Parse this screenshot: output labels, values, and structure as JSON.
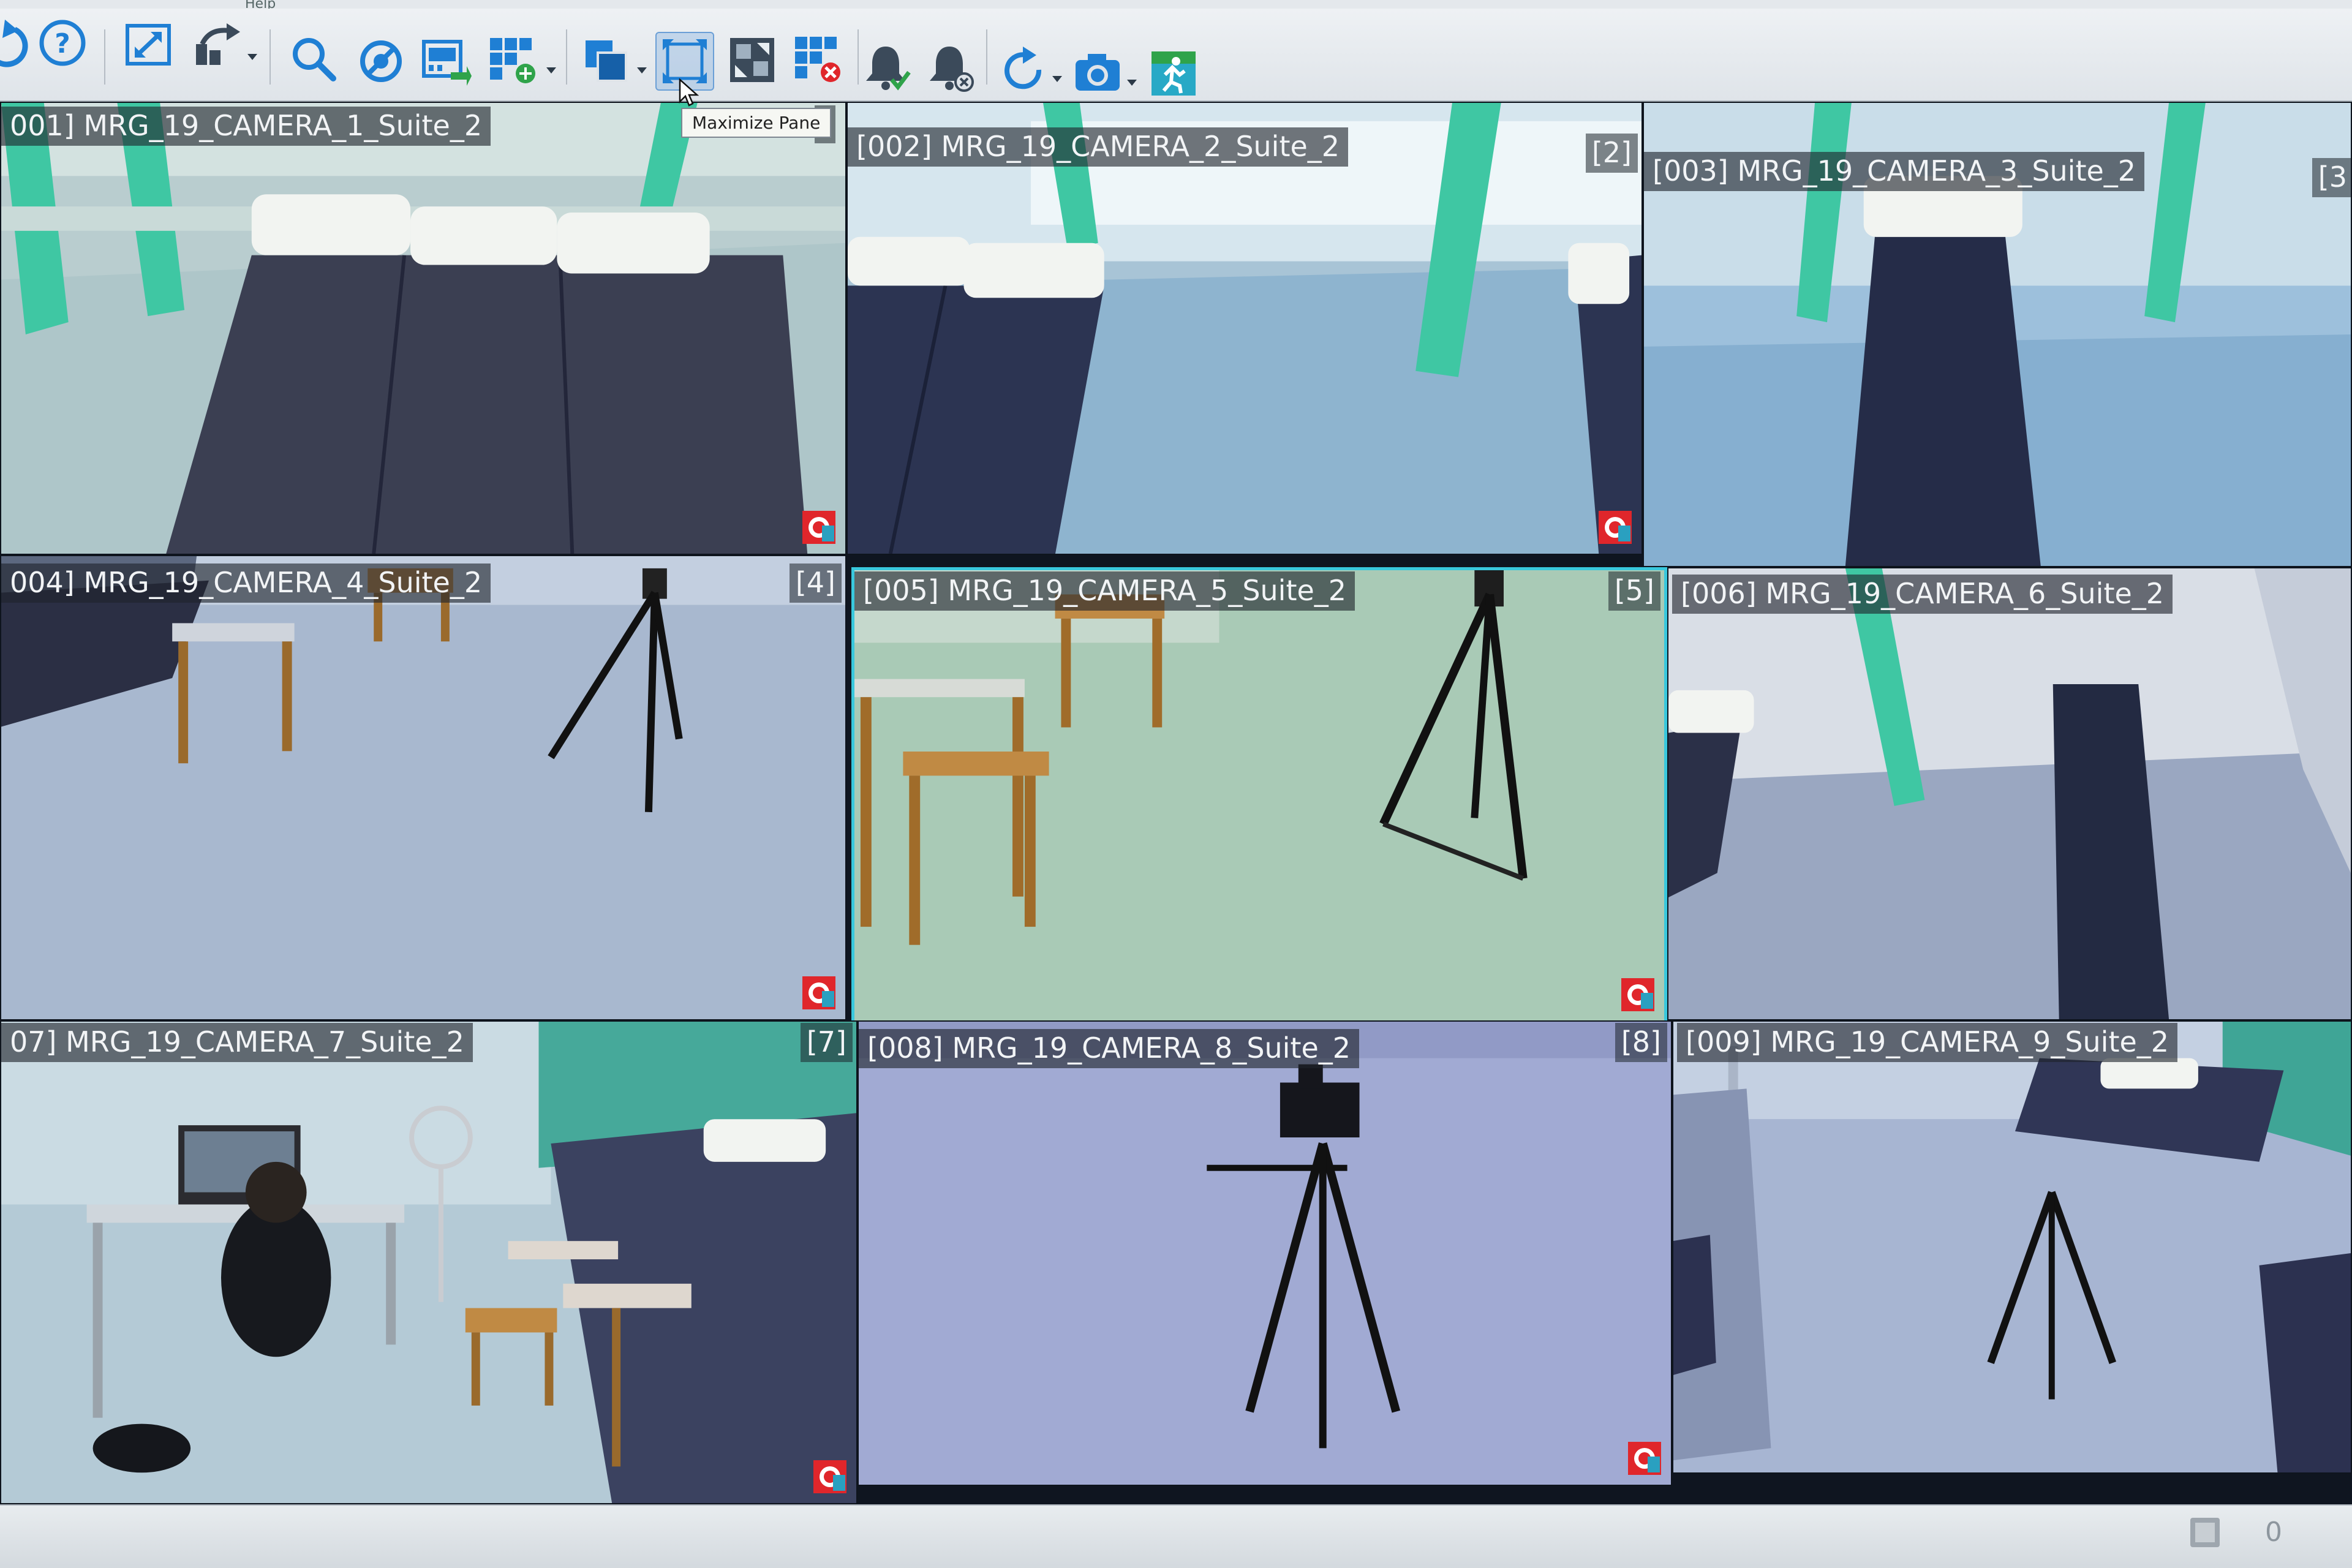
{
  "menubar": {
    "help_label": "Help"
  },
  "toolbar": {
    "tooltip": "Maximize Pane",
    "buttons": [
      "back-icon",
      "help-icon",
      "fullscreen-icon",
      "forward-share-icon",
      "search-icon",
      "disable-icon",
      "film-export-icon",
      "add-layout-icon",
      "layer-copy-icon",
      "maximize-pane-icon",
      "swap-pane-icon",
      "remove-layout-icon",
      "alarm-ack-icon",
      "alarm-clear-icon",
      "refresh-icon",
      "snapshot-camera-icon",
      "runner-icon"
    ]
  },
  "panes": [
    {
      "title": "001] MRG_19_CAMERA_1_Suite_2",
      "index": ""
    },
    {
      "title": "[002] MRG_19_CAMERA_2_Suite_2",
      "index": "[2]"
    },
    {
      "title": "[003] MRG_19_CAMERA_3_Suite_2",
      "index": "[3"
    },
    {
      "title": "004] MRG_19_CAMERA_4_Suite_2",
      "index": "[4]"
    },
    {
      "title": "[005] MRG_19_CAMERA_5_Suite_2",
      "index": "[5]"
    },
    {
      "title": "[006] MRG_19_CAMERA_6_Suite_2",
      "index": ""
    },
    {
      "title": "07] MRG_19_CAMERA_7_Suite_2",
      "index": "[7]"
    },
    {
      "title": "[008] MRG_19_CAMERA_8_Suite_2",
      "index": "[8]"
    },
    {
      "title": "[009] MRG_19_CAMERA_9_Suite_2",
      "index": ""
    }
  ],
  "tab_stub": "]",
  "status": {
    "count": "0"
  },
  "colors": {
    "selected_pane_border": "#39c8dd",
    "recording_indicator": "#e0262b",
    "toolbar_icon_blue": "#1f7fd4"
  }
}
